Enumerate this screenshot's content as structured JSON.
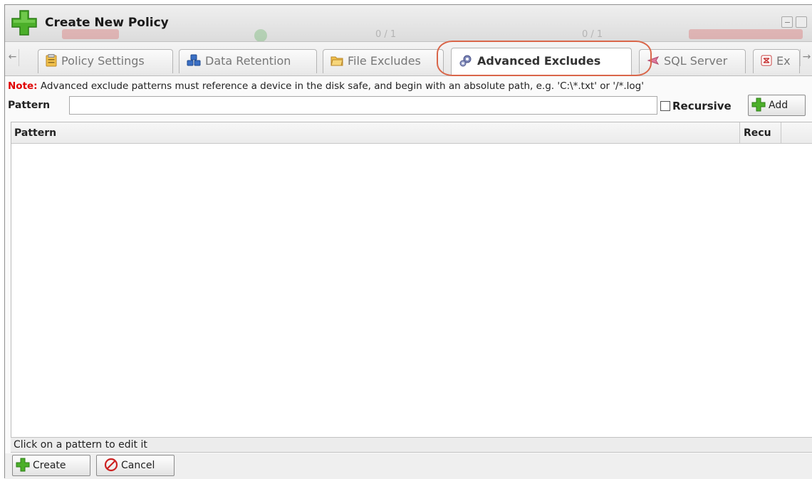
{
  "window": {
    "title": "Create New Policy"
  },
  "tabs": [
    {
      "label": "Policy Settings",
      "icon": "clipboard-icon",
      "active": false
    },
    {
      "label": "Data Retention",
      "icon": "stack-icon",
      "active": false
    },
    {
      "label": "File Excludes",
      "icon": "folder-icon",
      "active": false
    },
    {
      "label": "Advanced Excludes",
      "icon": "gear-icon",
      "active": true
    },
    {
      "label": "SQL Server",
      "icon": "database-icon",
      "active": false
    },
    {
      "label": "Ex",
      "icon": "exchange-icon",
      "active": false
    }
  ],
  "note": {
    "lead": "Note:",
    "text": " Advanced exclude patterns must reference a device in the disk safe, and begin with an absolute path, e.g. 'C:\\*.txt' or '/*.log'"
  },
  "pattern_form": {
    "label": "Pattern",
    "value": "",
    "recursive_label": "Recursive",
    "recursive_checked": false,
    "add_label": "Add"
  },
  "grid": {
    "columns": [
      "Pattern",
      "Recu"
    ],
    "rows": []
  },
  "status": "Click on a pattern to edit it",
  "footer": {
    "create_label": "Create",
    "cancel_label": "Cancel"
  },
  "colors": {
    "note_red": "#e00000",
    "highlight": "#d9664a",
    "plus_green": "#4caf2a",
    "cancel_red": "#cc2222"
  }
}
